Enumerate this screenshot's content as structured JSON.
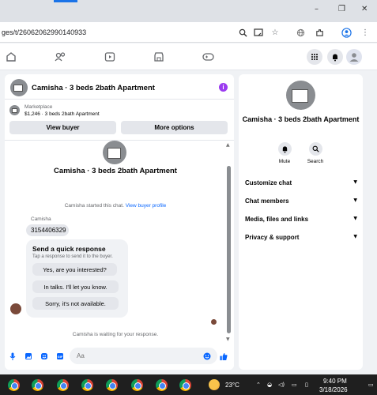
{
  "browser": {
    "url": "ges/t/26062062990140933",
    "window_controls": [
      "–",
      "❐",
      "✕"
    ]
  },
  "nav": {
    "icons": [
      "home-icon",
      "friends-icon",
      "video-icon",
      "marketplace-icon",
      "gaming-icon"
    ],
    "right_icons": [
      "menu-grid-icon",
      "notifications-icon",
      "profile-icon"
    ]
  },
  "chat": {
    "header_title": "Camisha · 3 beds 2bath Apartment",
    "info_label": "i",
    "listing": {
      "label": "Marketplace",
      "price_title": "$1,246 · 3 beds 2bath Apartment"
    },
    "view_buyer_label": "View buyer",
    "more_options_label": "More options",
    "center_title": "Camisha · 3 beds 2bath Apartment",
    "started_text": "Camisha started this chat.",
    "view_profile_link": "View buyer profile",
    "sender_name": "Camisha",
    "message": "3154406329",
    "quick_reply": {
      "title": "Send a quick response",
      "subtitle": "Tap a response to send it to the buyer.",
      "options": [
        "Yes, are you interested?",
        "In talks. I'll let you know.",
        "Sorry, it's not available."
      ]
    },
    "waiting_text": "Camisha is waiting for your response.",
    "composer_placeholder": "Aa"
  },
  "details": {
    "title": "Camisha · 3 beds 2bath Apartment",
    "mute_label": "Mute",
    "search_label": "Search",
    "rows": [
      "Customize chat",
      "Chat members",
      "Media, files and links",
      "Privacy & support"
    ]
  },
  "taskbar": {
    "temperature": "23°C",
    "time": "9:40 PM",
    "date": "3/18/2026"
  },
  "colors": {
    "accent": "#0866ff",
    "info_purple": "#9b3bf0"
  }
}
